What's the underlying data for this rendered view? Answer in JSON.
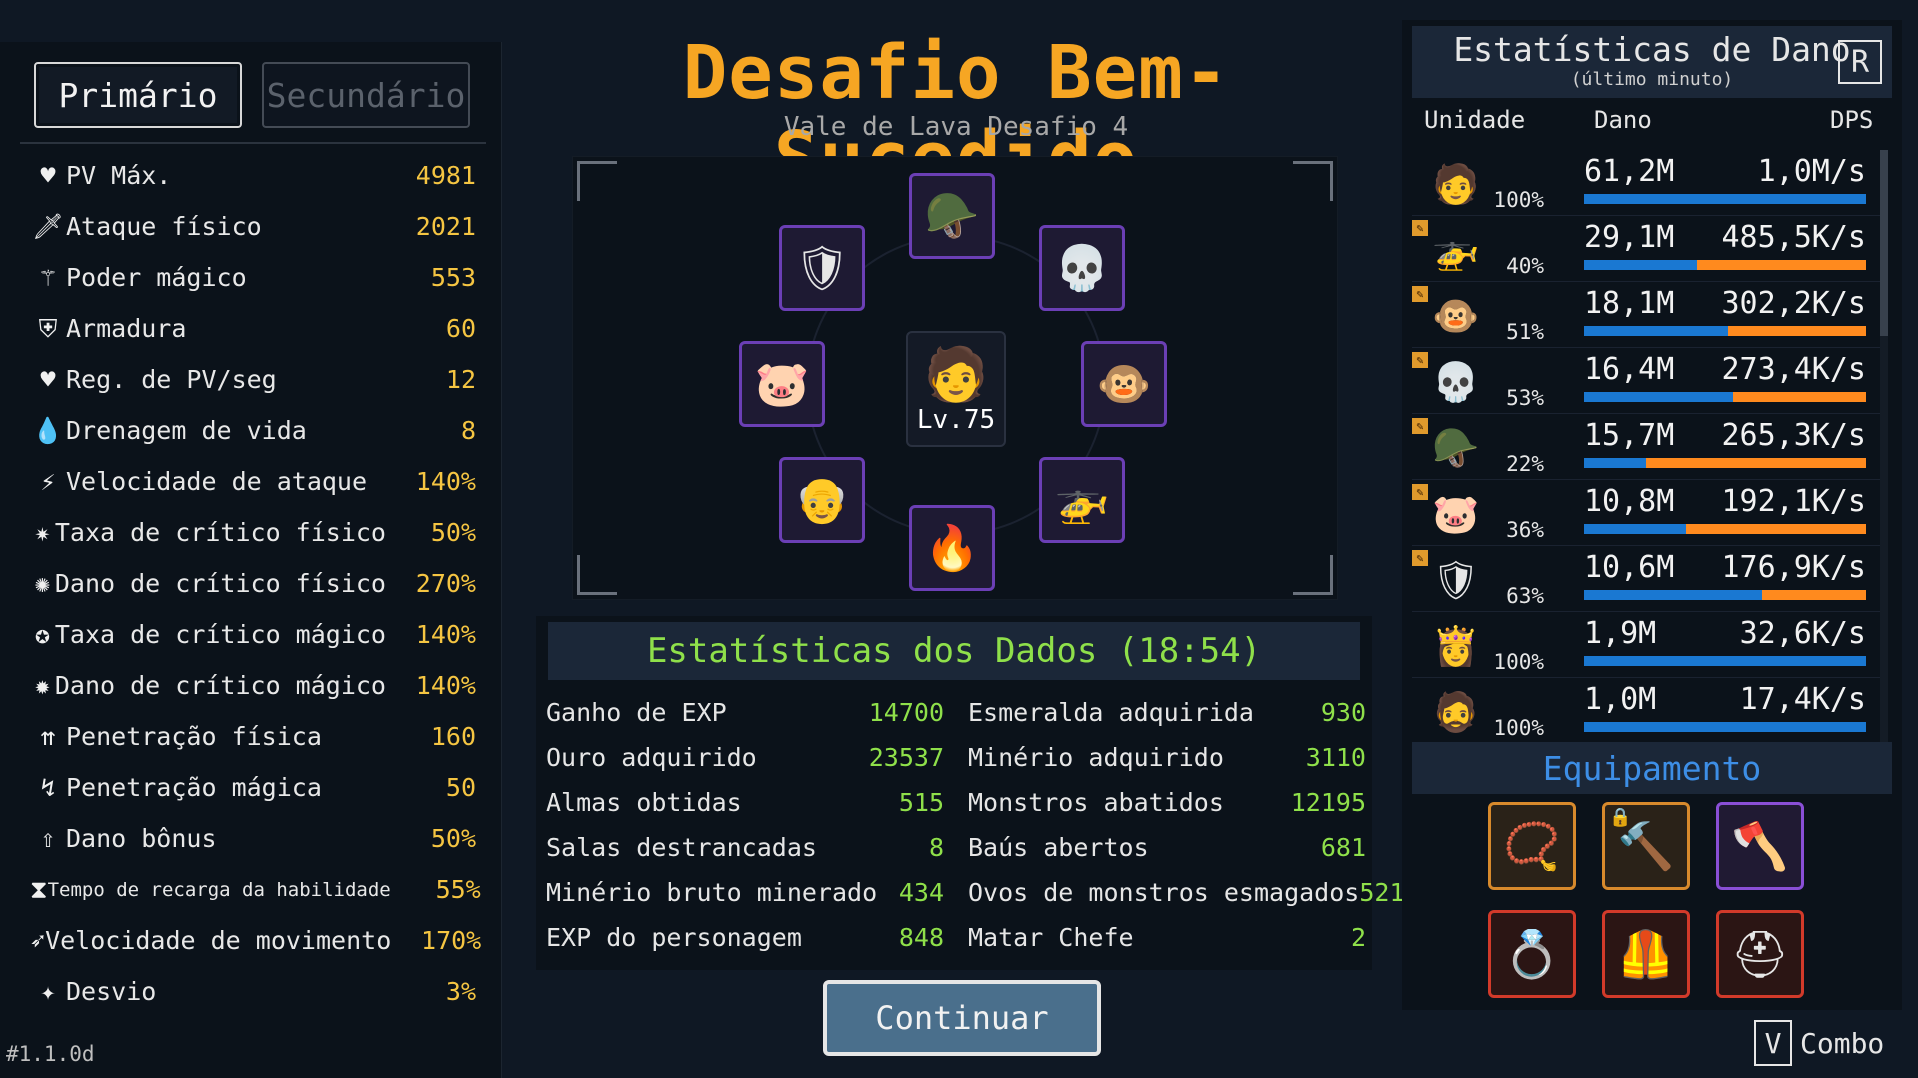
{
  "tabs": {
    "primary": "Primário",
    "secondary": "Secundário"
  },
  "stats": [
    {
      "icon": "heart-icon",
      "glyph": "♥",
      "label": "PV Máx.",
      "value": "4981"
    },
    {
      "icon": "sword-icon",
      "glyph": "🗡",
      "label": "Ataque físico",
      "value": "2021"
    },
    {
      "icon": "staff-icon",
      "glyph": "⚚",
      "label": "Poder mágico",
      "value": "553"
    },
    {
      "icon": "shield-icon",
      "glyph": "⛨",
      "label": "Armadura",
      "value": "60"
    },
    {
      "icon": "heart-plus-icon",
      "glyph": "♥",
      "label": "Reg. de PV/seg",
      "value": "12"
    },
    {
      "icon": "blood-drop-icon",
      "glyph": "💧",
      "label": "Drenagem de vida",
      "value": "8"
    },
    {
      "icon": "lightning-icon",
      "glyph": "⚡",
      "label": "Velocidade de ataque",
      "value": "140%"
    },
    {
      "icon": "crit-rate-icon",
      "glyph": "✷",
      "label": "Taxa de crítico físico",
      "value": "50%"
    },
    {
      "icon": "crit-damage-icon",
      "glyph": "✺",
      "label": "Dano de crítico físico",
      "value": "270%"
    },
    {
      "icon": "magic-crit-rate-icon",
      "glyph": "✪",
      "label": "Taxa de crítico mágico",
      "value": "140%"
    },
    {
      "icon": "magic-crit-damage-icon",
      "glyph": "✹",
      "label": "Dano de crítico mágico",
      "value": "140%"
    },
    {
      "icon": "physical-penetration-icon",
      "glyph": "⇈",
      "label": "Penetração física",
      "value": "160"
    },
    {
      "icon": "magic-penetration-icon",
      "glyph": "↯",
      "label": "Penetração mágica",
      "value": "50"
    },
    {
      "icon": "bonus-damage-icon",
      "glyph": "⇧",
      "label": "Dano bônus",
      "value": "50%"
    },
    {
      "icon": "hourglass-icon",
      "glyph": "⧗",
      "label": "Tempo de recarga da habilidade",
      "value": "55%",
      "small": true
    },
    {
      "icon": "boot-icon",
      "glyph": "➶",
      "label": "Velocidade de movimento",
      "value": "170%"
    },
    {
      "icon": "dodge-icon",
      "glyph": "✦",
      "label": "Desvio",
      "value": "3%"
    }
  ],
  "version": "#1.1.0d",
  "title": "Desafio Bem-Sucedido",
  "subtitle": "Vale de Lava Desafio 4",
  "party": {
    "center_level": "Lv.75",
    "heroes": [
      "warlord",
      "skeleton-knight",
      "monkey-king",
      "gunship",
      "phoenix-warrior",
      "bald-monk",
      "pig-warrior",
      "dark-knight"
    ]
  },
  "data_stats": {
    "header": "Estatísticas dos Dados (18:54)",
    "left": [
      {
        "label": "Ganho de EXP",
        "value": "14700"
      },
      {
        "label": "Ouro adquirido",
        "value": "23537"
      },
      {
        "label": "Almas obtidas",
        "value": "515"
      },
      {
        "label": "Salas destrancadas",
        "value": "8"
      },
      {
        "label": "Minério bruto minerado",
        "value": "434"
      },
      {
        "label": "EXP do personagem",
        "value": "848"
      }
    ],
    "right": [
      {
        "label": "Esmeralda adquirida",
        "value": "930"
      },
      {
        "label": "Minério adquirido",
        "value": "3110"
      },
      {
        "label": "Monstros abatidos",
        "value": "12195"
      },
      {
        "label": "Baús abertos",
        "value": "681"
      },
      {
        "label": "Ovos de monstros esmagados",
        "value": "521"
      },
      {
        "label": "Matar Chefe",
        "value": "2"
      }
    ]
  },
  "continue_label": "Continuar",
  "damage": {
    "title": "Estatísticas de Dano",
    "subtitle": "(último minuto)",
    "key": "R",
    "columns": {
      "unit": "Unidade",
      "damage": "Dano",
      "dps": "DPS"
    },
    "rows": [
      {
        "portrait": "🧑",
        "tag": false,
        "pct": "100%",
        "damage": "61,2M",
        "dps": "1,0M/s",
        "share": 1.0
      },
      {
        "portrait": "🚁",
        "tag": true,
        "pct": "40%",
        "damage": "29,1M",
        "dps": "485,5K/s",
        "share": 0.4
      },
      {
        "portrait": "🐵",
        "tag": true,
        "pct": "51%",
        "damage": "18,1M",
        "dps": "302,2K/s",
        "share": 0.51
      },
      {
        "portrait": "💀",
        "tag": true,
        "pct": "53%",
        "damage": "16,4M",
        "dps": "273,4K/s",
        "share": 0.53
      },
      {
        "portrait": "🪖",
        "tag": true,
        "pct": "22%",
        "damage": "15,7M",
        "dps": "265,3K/s",
        "share": 0.22
      },
      {
        "portrait": "🐷",
        "tag": true,
        "pct": "36%",
        "damage": "10,8M",
        "dps": "192,1K/s",
        "share": 0.36
      },
      {
        "portrait": "🛡",
        "tag": true,
        "pct": "63%",
        "damage": "10,6M",
        "dps": "176,9K/s",
        "share": 0.63
      },
      {
        "portrait": "👸",
        "tag": false,
        "pct": "100%",
        "damage": "1,9M",
        "dps": "32,6K/s",
        "share": 1.0
      },
      {
        "portrait": "🧔",
        "tag": false,
        "pct": "100%",
        "damage": "1,0M",
        "dps": "17,4K/s",
        "share": 1.0
      }
    ]
  },
  "equipment": {
    "title": "Equipamento",
    "slots": [
      {
        "name": "necklace-icon",
        "glyph": "📿",
        "frame": "orange",
        "locked": false
      },
      {
        "name": "hammer-icon",
        "glyph": "🔨",
        "frame": "orange",
        "locked": true
      },
      {
        "name": "axe-icon",
        "glyph": "🪓",
        "frame": "purple",
        "locked": false
      },
      {
        "name": "ring-icon",
        "glyph": "💍",
        "frame": "red",
        "locked": false
      },
      {
        "name": "armor-icon",
        "glyph": "🦺",
        "frame": "red",
        "locked": false
      },
      {
        "name": "helmet-icon",
        "glyph": "⛑",
        "frame": "red",
        "locked": false
      }
    ]
  },
  "combo": {
    "key": "V",
    "label": "Combo"
  }
}
